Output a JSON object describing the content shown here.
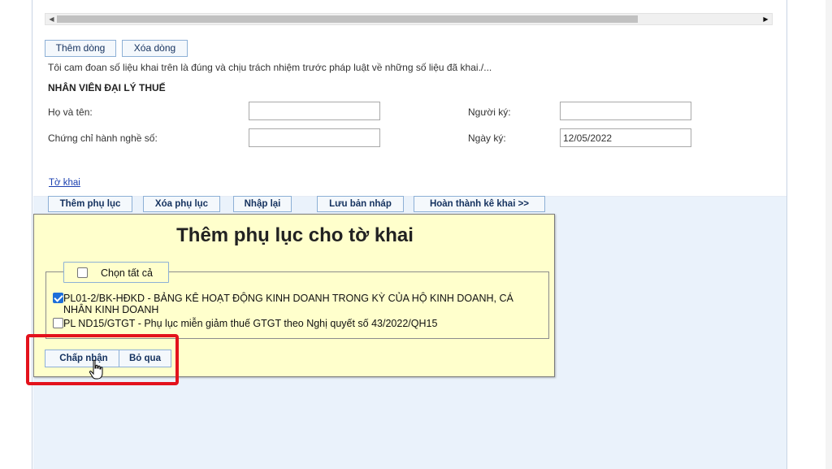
{
  "toolbar_top": {
    "add_row": "Thêm dòng",
    "delete_row": "Xóa dòng"
  },
  "declaration": "Tôi cam đoan số liệu khai trên là đúng và chịu trách nhiệm trước pháp luật về những số liệu đã khai./...",
  "agent_section": {
    "heading": "NHÂN VIÊN ĐẠI LÝ THUẾ",
    "name_label": "Họ và tên:",
    "name_value": "",
    "cert_label": "Chứng chỉ hành nghề số:",
    "cert_value": "",
    "signer_label": "Người ký:",
    "signer_value": "",
    "sign_date_label": "Ngày ký:",
    "sign_date_value": "12/05/2022"
  },
  "tab_link": "Tờ khai",
  "actions": {
    "add_appendix": "Thêm phụ lục",
    "delete_appendix": "Xóa phụ lục",
    "reenter": "Nhập lại",
    "save_draft": "Lưu bản nháp",
    "complete": "Hoàn thành kê khai >>"
  },
  "dialog": {
    "title": "Thêm phụ lục cho tờ khai",
    "select_all": "Chọn tất cả",
    "select_all_checked": false,
    "items": [
      {
        "label": "PL01-2/BK-HĐKD - BẢNG KÊ HOẠT ĐỘNG KINH DOANH TRONG KỲ CỦA HỘ KINH DOANH, CÁ NHÂN KINH DOANH",
        "checked": true
      },
      {
        "label": "PL ND15/GTGT - Phụ lục miễn giảm thuế GTGT theo Nghị quyết số 43/2022/QH15",
        "checked": false
      }
    ],
    "accept": "Chấp nhận",
    "skip": "Bỏ qua"
  },
  "colors": {
    "dialog_bg": "#ffffcc",
    "highlight": "#e3121c",
    "panel_bg": "#eaf2fb",
    "button_text": "#14315e"
  }
}
